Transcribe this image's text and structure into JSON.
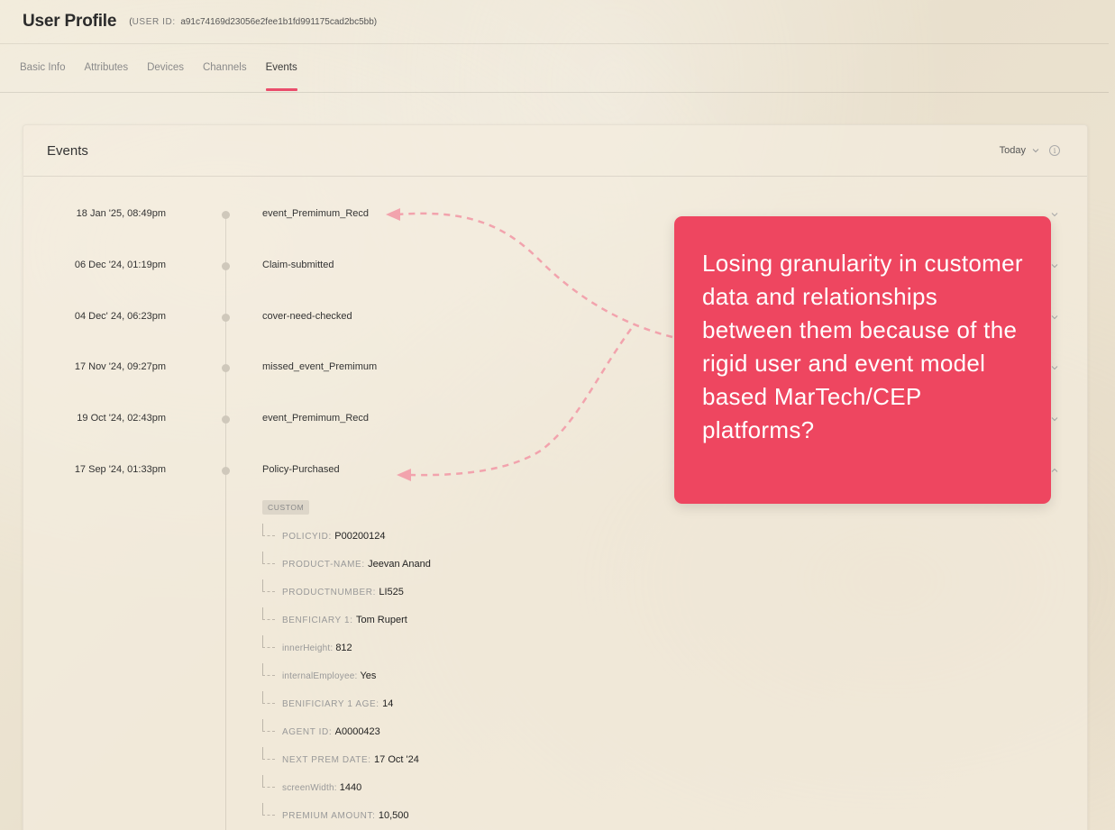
{
  "header": {
    "title": "User Profile",
    "user_id_label": "USER ID:",
    "user_id_value": "a91c74169d23056e2fee1b1fd991175cad2bc5bb"
  },
  "tabs": [
    {
      "label": "Basic Info",
      "active": false
    },
    {
      "label": "Attributes",
      "active": false
    },
    {
      "label": "Devices",
      "active": false
    },
    {
      "label": "Channels",
      "active": false
    },
    {
      "label": "Events",
      "active": true
    }
  ],
  "card": {
    "title": "Events",
    "range_label": "Today",
    "info_glyph": "i"
  },
  "events": [
    {
      "date": "18 Jan '25, 08:49pm",
      "name": "event_Premimum_Recd",
      "expanded": false
    },
    {
      "date": "06 Dec '24, 01:19pm",
      "name": "Claim-submitted",
      "expanded": false
    },
    {
      "date": "04 Dec' 24, 06:23pm",
      "name": "cover-need-checked",
      "expanded": false
    },
    {
      "date": "17 Nov '24, 09:27pm",
      "name": "missed_event_Premimum",
      "expanded": false
    },
    {
      "date": "19 Oct '24, 02:43pm",
      "name": "event_Premimum_Recd",
      "expanded": false
    },
    {
      "date": "17 Sep '24, 01:33pm",
      "name": "Policy-Purchased",
      "expanded": true
    }
  ],
  "expanded_event": {
    "badge": "CUSTOM",
    "attributes": [
      {
        "key": "POLICYID:",
        "value": "P00200124"
      },
      {
        "key": "PRODUCT-NAME:",
        "value": "Jeevan Anand"
      },
      {
        "key": "PRODUCTNUMBER:",
        "value": "LI525"
      },
      {
        "key": "BENFICIARY 1:",
        "value": "Tom Rupert"
      },
      {
        "key": "innerHeight:",
        "value": "812"
      },
      {
        "key": "internalEmployee:",
        "value": "Yes"
      },
      {
        "key": "BENIFICIARY 1 AGE:",
        "value": "14"
      },
      {
        "key": "AGENT ID:",
        "value": "A0000423"
      },
      {
        "key": "NEXT PREM DATE:",
        "value": "17 Oct '24"
      },
      {
        "key": "screenWidth:",
        "value": "1440"
      },
      {
        "key": "PREMIUM AMOUNT:",
        "value": "10,500"
      }
    ]
  },
  "callout": {
    "text": "Losing granularity in customer data and relationships between them because of the rigid user and event model based MarTech/CEP platforms?"
  },
  "colors": {
    "accent": "#ea4d6b",
    "callout_bg": "#ee4660",
    "arrow": "#f2a3ad"
  }
}
